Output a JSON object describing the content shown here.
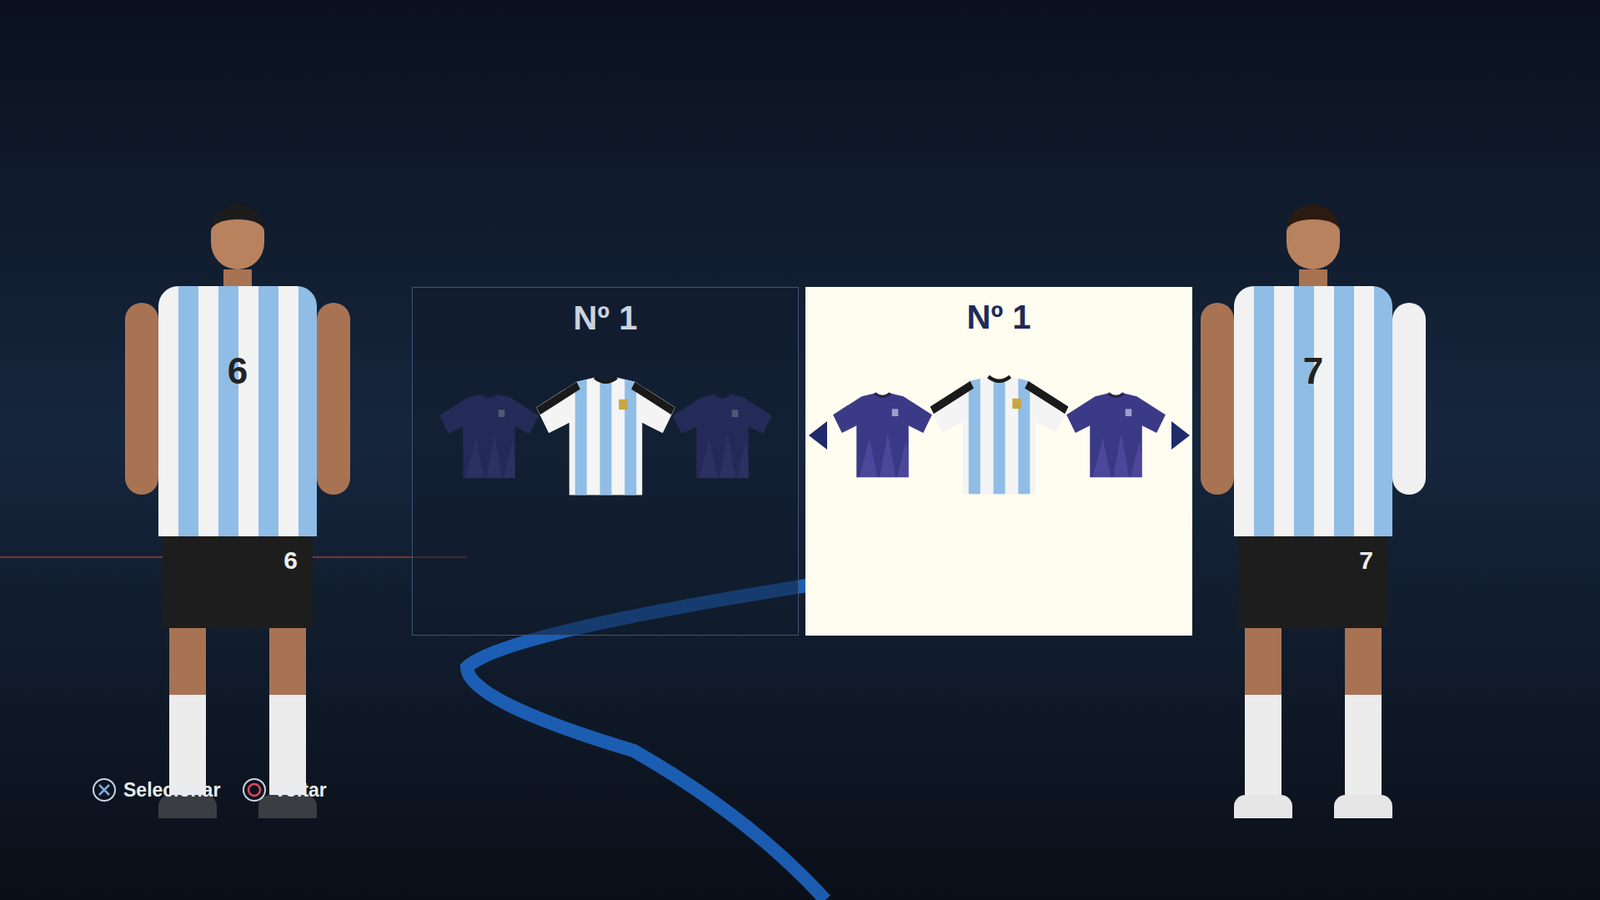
{
  "kit_panels": [
    {
      "title": "Nº 1",
      "selected": false,
      "kits": [
        {
          "kind": "plain",
          "color": "#3b3a86"
        },
        {
          "kind": "striped",
          "color": "#8fbde6"
        },
        {
          "kind": "plain",
          "color": "#3b3a86"
        }
      ]
    },
    {
      "title": "Nº 1",
      "selected": true,
      "kits": [
        {
          "kind": "plain",
          "color": "#3b3a86"
        },
        {
          "kind": "striped",
          "color": "#8fbde6"
        },
        {
          "kind": "plain",
          "color": "#3b3a86"
        }
      ]
    }
  ],
  "players": [
    {
      "number": "6"
    },
    {
      "number": "7"
    }
  ],
  "controls": [
    {
      "kind": "cross",
      "label": "Selecionar"
    },
    {
      "kind": "circle",
      "label": "Voltar"
    }
  ]
}
